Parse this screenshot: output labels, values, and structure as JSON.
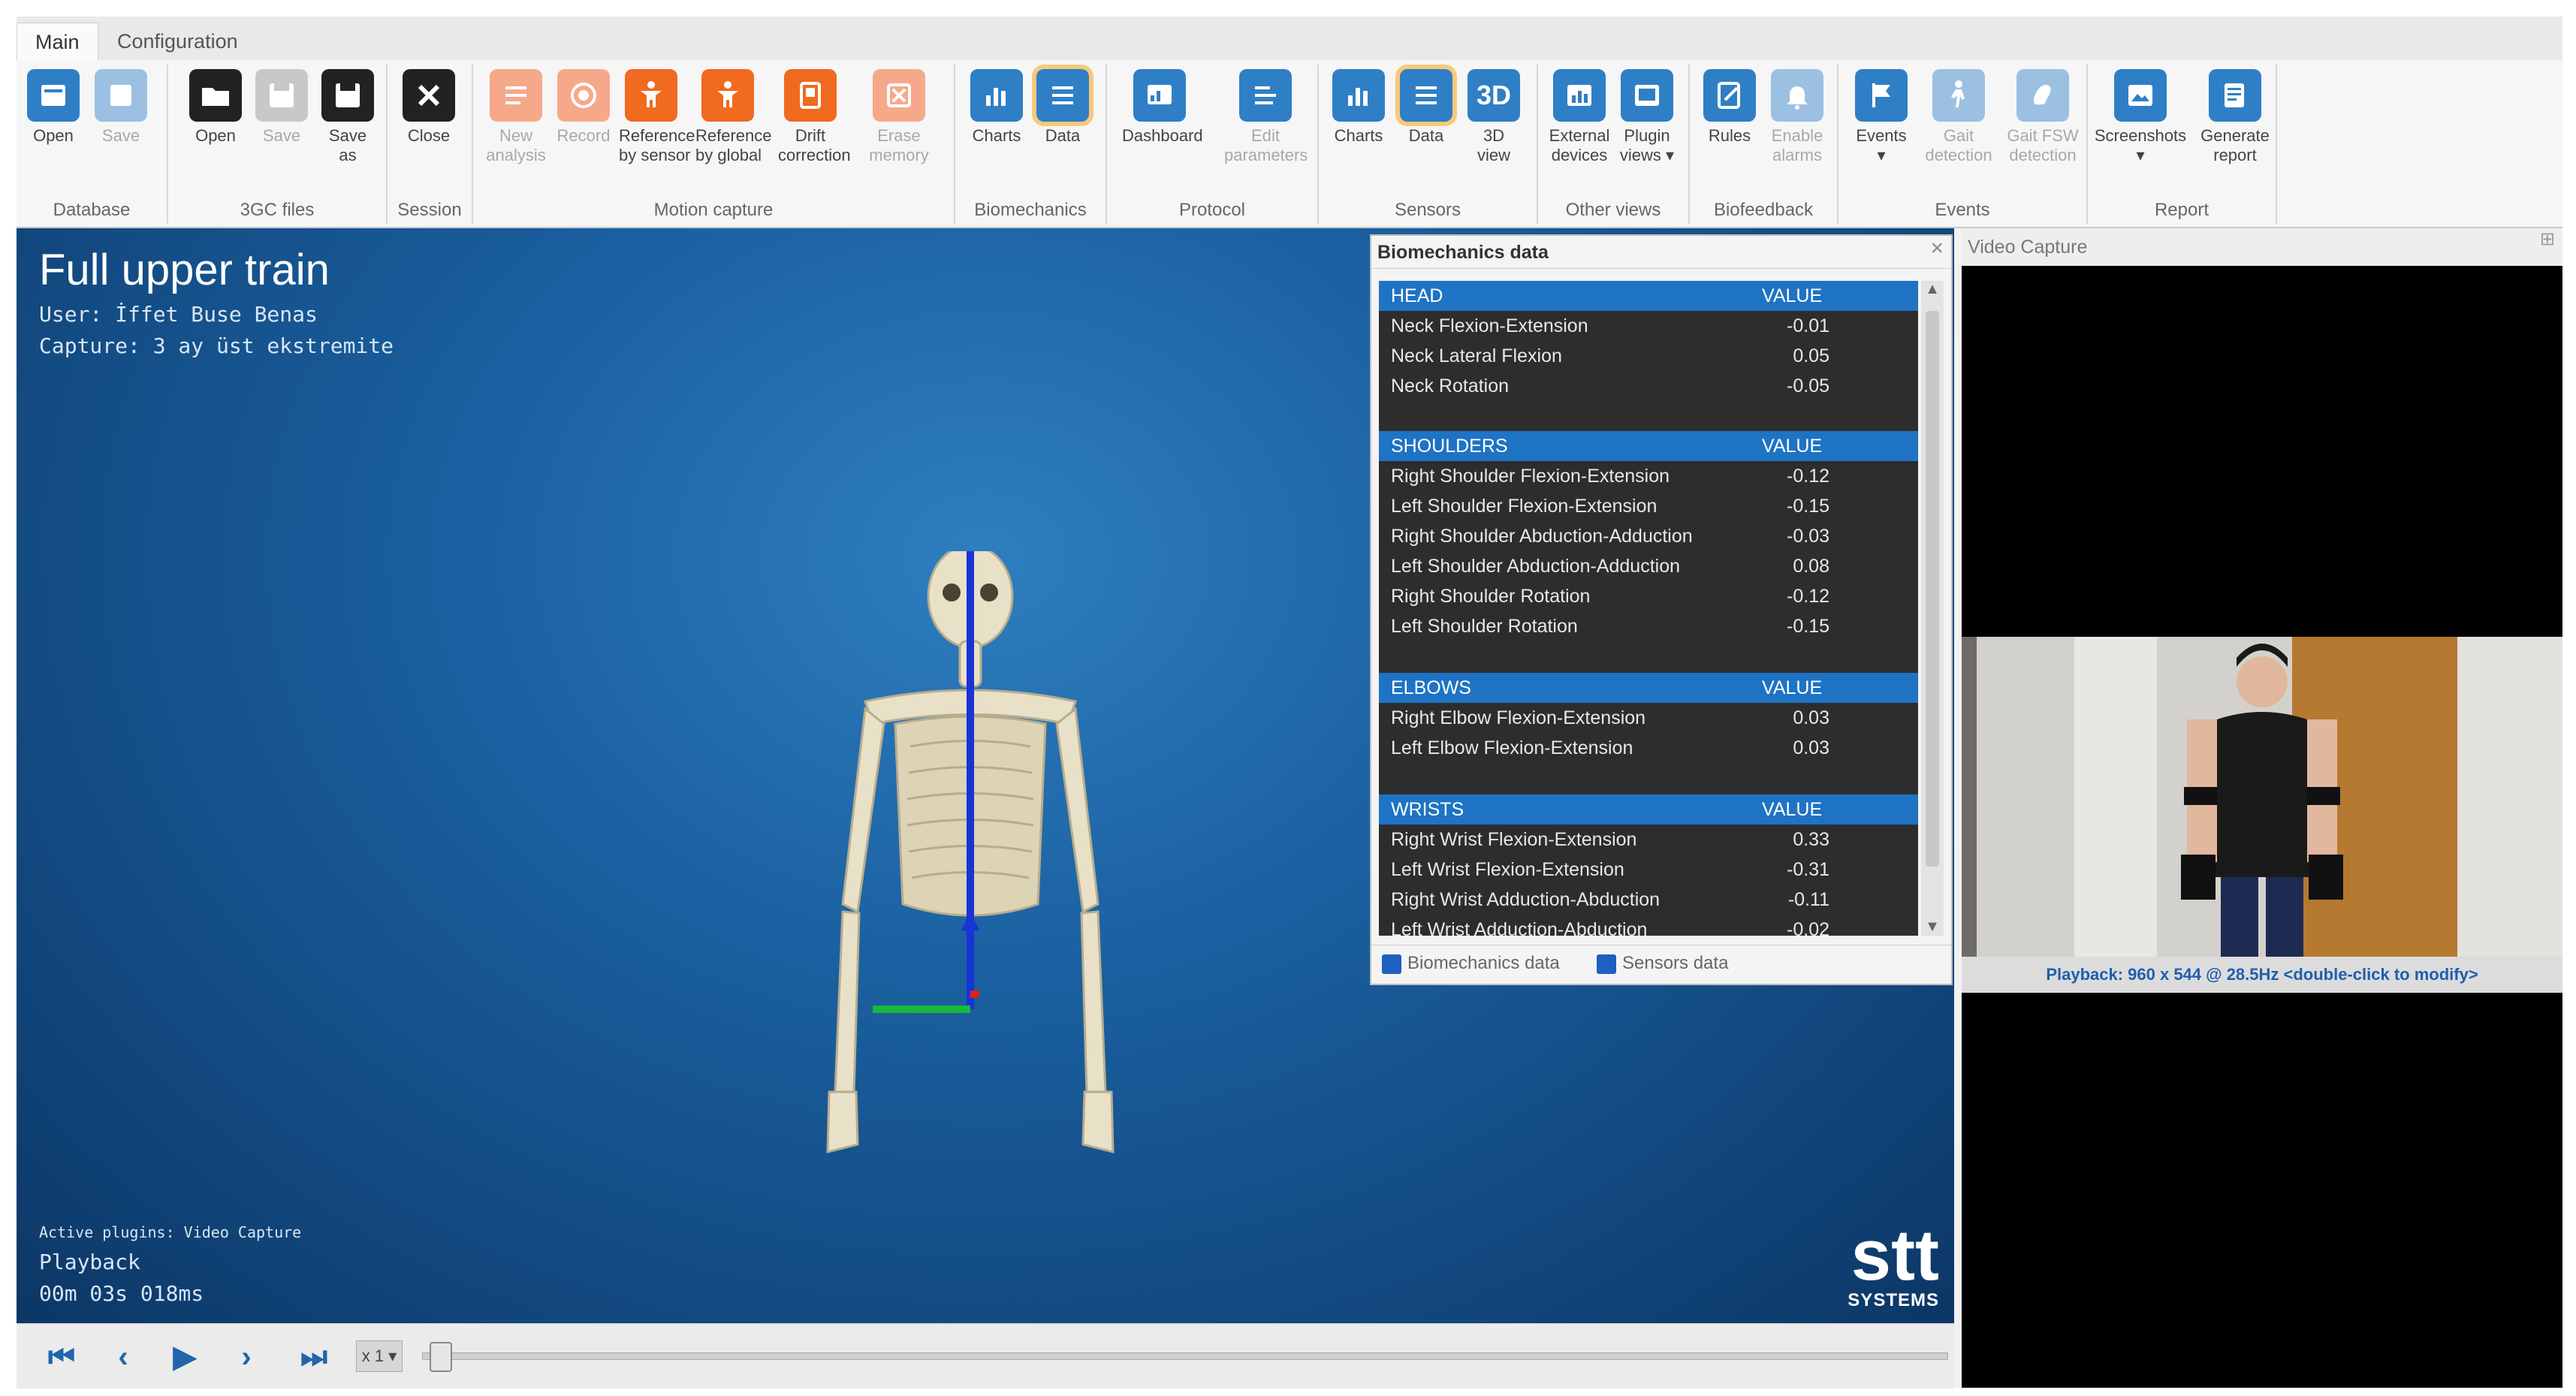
{
  "tabs": {
    "main": "Main",
    "configuration": "Configuration"
  },
  "ribbon": {
    "groups": {
      "database": "Database",
      "files": "3GC files",
      "session": "Session",
      "motion": "Motion capture",
      "biomechanics": "Biomechanics",
      "protocol": "Protocol",
      "sensors": "Sensors",
      "other_views": "Other views",
      "biofeedback": "Biofeedback",
      "events": "Events",
      "report": "Report"
    },
    "buttons": {
      "db_open": "Open",
      "db_save": "Save",
      "f_open": "Open",
      "f_save": "Save",
      "f_save_as_1": "Save",
      "f_save_as_2": "as",
      "close": "Close",
      "new_1": "New",
      "new_2": "analysis",
      "record": "Record",
      "ref_sensor_1": "Reference",
      "ref_sensor_2": "by sensor",
      "ref_global_1": "Reference",
      "ref_global_2": "by global",
      "drift_1": "Drift",
      "drift_2": "correction",
      "erase_1": "Erase",
      "erase_2": "memory",
      "bio_charts": "Charts",
      "bio_data": "Data",
      "dashboard": "Dashboard",
      "edit_1": "Edit",
      "edit_2": "parameters",
      "sen_charts": "Charts",
      "sen_data": "Data",
      "view3d_icon": "3D",
      "view3d_1": "3D",
      "view3d_2": "view",
      "ext_1": "External",
      "ext_2": "devices",
      "plugin_1": "Plugin",
      "plugin_2": "views",
      "rules": "Rules",
      "enable_1": "Enable",
      "enable_2": "alarms",
      "events": "Events",
      "gait_1": "Gait",
      "gait_2": "detection",
      "gaitfsw_1": "Gait FSW",
      "gaitfsw_2": "detection",
      "screenshots": "Screenshots",
      "gen_1": "Generate",
      "gen_2": "report"
    }
  },
  "viewport": {
    "title": "Full upper train",
    "user": "User: İffet Buse Benas",
    "capture": "Capture: 3 ay üst ekstremite",
    "plugins": "Active plugins: Video Capture",
    "mode": "Playback",
    "time": "00m 03s 018ms",
    "logo_text": "stt",
    "logo_sub": "SYSTEMS"
  },
  "bio_panel": {
    "title": "Biomechanics data",
    "close": "×",
    "value_header": "VALUE",
    "sections": [
      {
        "name": "HEAD",
        "rows": [
          {
            "name": "Neck Flexion-Extension",
            "value": "-0.01"
          },
          {
            "name": "Neck Lateral Flexion",
            "value": "0.05"
          },
          {
            "name": "Neck Rotation",
            "value": "-0.05"
          }
        ]
      },
      {
        "name": "SHOULDERS",
        "rows": [
          {
            "name": "Right Shoulder Flexion-Extension",
            "value": "-0.12"
          },
          {
            "name": "Left Shoulder Flexion-Extension",
            "value": "-0.15"
          },
          {
            "name": "Right Shoulder Abduction-Adduction",
            "value": "-0.03"
          },
          {
            "name": "Left Shoulder Abduction-Adduction",
            "value": "0.08"
          },
          {
            "name": "Right Shoulder Rotation",
            "value": "-0.12"
          },
          {
            "name": "Left Shoulder Rotation",
            "value": "-0.15"
          }
        ]
      },
      {
        "name": "ELBOWS",
        "rows": [
          {
            "name": "Right Elbow Flexion-Extension",
            "value": "0.03"
          },
          {
            "name": "Left Elbow Flexion-Extension",
            "value": "0.03"
          }
        ]
      },
      {
        "name": "WRISTS",
        "rows": [
          {
            "name": "Right Wrist Flexion-Extension",
            "value": "0.33"
          },
          {
            "name": "Left Wrist Flexion-Extension",
            "value": "-0.31"
          },
          {
            "name": "Right Wrist Adduction-Abduction",
            "value": "-0.11"
          },
          {
            "name": "Left Wrist Adduction-Abduction",
            "value": "-0.02"
          }
        ]
      }
    ],
    "tabs": {
      "bio": "Biomechanics data",
      "sensors": "Sensors data"
    }
  },
  "playback": {
    "speed": "x 1"
  },
  "video": {
    "title": "Video Capture",
    "pin": "⊞",
    "caption": "Playback: 960 x 544 @ 28.5Hz <double-click to modify>"
  },
  "colors": {
    "accent": "#2f7fc6",
    "orange": "#f06a1f",
    "header_blue": "#1e73c4"
  }
}
